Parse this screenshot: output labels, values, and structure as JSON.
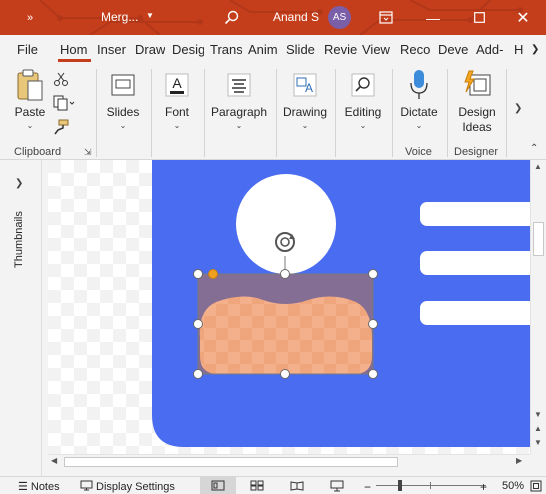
{
  "titlebar": {
    "doc_name": "Merg...",
    "user_name": "Anand S",
    "avatar_initials": "AS",
    "accent": "#c43e1c"
  },
  "tabs": [
    {
      "label": "File"
    },
    {
      "label": "Hom",
      "active": true
    },
    {
      "label": "Inser"
    },
    {
      "label": "Draw"
    },
    {
      "label": "Desig"
    },
    {
      "label": "Trans"
    },
    {
      "label": "Anim"
    },
    {
      "label": "Slide"
    },
    {
      "label": "Revie"
    },
    {
      "label": "View"
    },
    {
      "label": "Reco"
    },
    {
      "label": "Deve"
    },
    {
      "label": "Add-"
    },
    {
      "label": "H"
    }
  ],
  "ribbon": {
    "paste_label": "Paste",
    "slides_label": "Slides",
    "font_label": "Font",
    "paragraph_label": "Paragraph",
    "drawing_label": "Drawing",
    "editing_label": "Editing",
    "dictate_label": "Dictate",
    "design_ideas_label": "Design Ideas",
    "groups": {
      "clipboard": "Clipboard",
      "voice": "Voice",
      "designer": "Designer"
    }
  },
  "thumbnails_label": "Thumbnails",
  "slide": {
    "background_color": "#4a6cf0",
    "shape_fill": "#f4b08a",
    "selection_fill": "#8b6f8a"
  },
  "statusbar": {
    "notes_label": "Notes",
    "display_settings_label": "Display Settings",
    "zoom": "50%",
    "zoom_minus": "−",
    "zoom_plus": "+"
  }
}
